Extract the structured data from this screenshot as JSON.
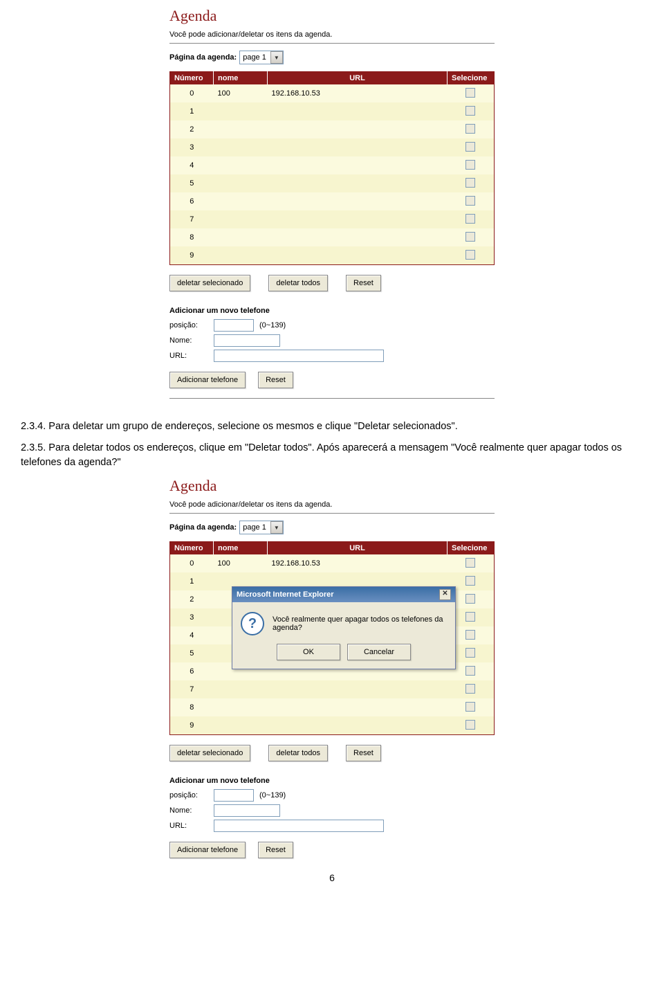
{
  "shared": {
    "panel_title": "Agenda",
    "panel_subtitle": "Você pode adicionar/deletar os itens da agenda.",
    "page_label": "Página da agenda:",
    "page_value": "page 1",
    "table_headers": {
      "numero": "Número",
      "nome": "nome",
      "url": "URL",
      "selecione": "Selecione"
    },
    "rows": [
      {
        "num": "0",
        "nome": "100",
        "url": "192.168.10.53"
      },
      {
        "num": "1",
        "nome": "",
        "url": ""
      },
      {
        "num": "2",
        "nome": "",
        "url": ""
      },
      {
        "num": "3",
        "nome": "",
        "url": ""
      },
      {
        "num": "4",
        "nome": "",
        "url": ""
      },
      {
        "num": "5",
        "nome": "",
        "url": ""
      },
      {
        "num": "6",
        "nome": "",
        "url": ""
      },
      {
        "num": "7",
        "nome": "",
        "url": ""
      },
      {
        "num": "8",
        "nome": "",
        "url": ""
      },
      {
        "num": "9",
        "nome": "",
        "url": ""
      }
    ],
    "btn_del_sel": "deletar selecionado",
    "btn_del_all": "deletar todos",
    "btn_reset": "Reset",
    "add_heading": "Adicionar um novo telefone",
    "lbl_posicao": "posição:",
    "hint_posicao": "(0~139)",
    "lbl_nome": "Nome:",
    "lbl_url": "URL:",
    "btn_add": "Adicionar telefone"
  },
  "body": {
    "p234": "2.3.4. Para deletar um grupo de endereços, selecione os mesmos e clique \"Deletar selecionados\".",
    "p235": "2.3.5. Para deletar todos os endereços, clique em \"Deletar todos\".  Após aparecerá a mensagem \"Você realmente quer apagar todos os telefones da agenda?\""
  },
  "dialog": {
    "title": "Microsoft Internet Explorer",
    "message": "Você realmente quer apagar todos os telefones da agenda?",
    "ok": "OK",
    "cancel": "Cancelar"
  },
  "page_number": "6"
}
